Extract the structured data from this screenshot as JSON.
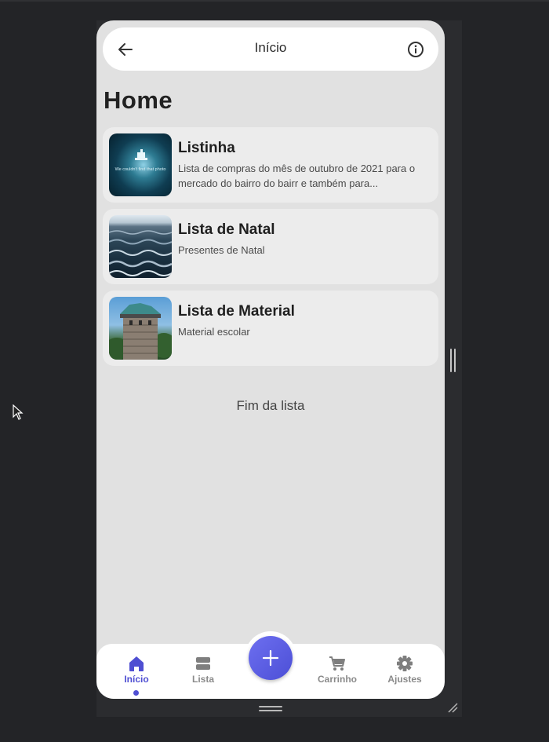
{
  "appbar": {
    "title": "Início",
    "back_icon": "arrow-left-icon",
    "info_icon": "info-circle-icon"
  },
  "page": {
    "title": "Home"
  },
  "lists": [
    {
      "title": "Listinha",
      "description": "Lista de compras do mês de outubro de 2021 para o mercado do bairro do bairr e também para...",
      "thumbnail": "unavailable-photo-placeholder",
      "thumbnail_text": "We couldn't find that photo"
    },
    {
      "title": "Lista de Natal",
      "description": "Presentes de Natal",
      "thumbnail": "sea-waves-photo"
    },
    {
      "title": "Lista de Material",
      "description": "Material escolar",
      "thumbnail": "stone-tower-photo"
    }
  ],
  "end_of_list": "Fim da lista",
  "bottom_nav": {
    "items": [
      {
        "label": "Início",
        "icon": "home-icon",
        "active": true
      },
      {
        "label": "Lista",
        "icon": "list-icon",
        "active": false
      },
      {
        "label": "Carrinho",
        "icon": "cart-icon",
        "active": false
      },
      {
        "label": "Ajustes",
        "icon": "gear-icon",
        "active": false
      }
    ],
    "fab_icon": "plus-icon"
  },
  "colors": {
    "accent": "#4f4fd2",
    "page_background": "#e1e1e1",
    "card_background": "#ececec",
    "inactive_nav": "#8a8a8a"
  }
}
